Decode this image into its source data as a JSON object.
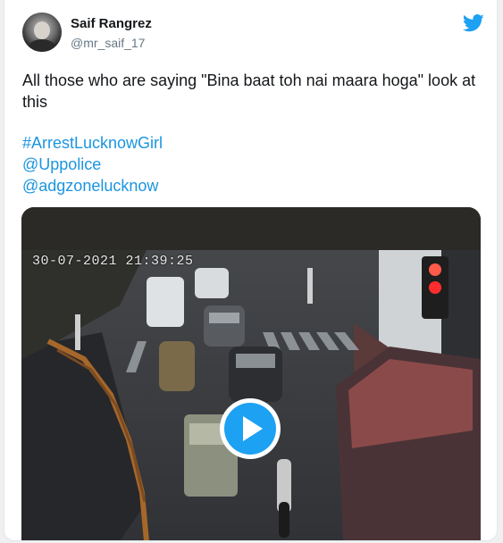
{
  "user": {
    "name": "Saif Rangrez",
    "handle": "@mr_saif_17"
  },
  "tweet": {
    "text": "All those who are saying \"Bina baat toh nai maara hoga\" look at this",
    "hashtag": "#ArrestLucknowGirl",
    "mention_1": "@Uppolice",
    "mention_2": "@adgzonelucknow"
  },
  "video": {
    "timestamp": "30-07-2021 21:39:25"
  },
  "icons": {
    "brand": "twitter-bird-icon",
    "play": "play-icon"
  },
  "colors": {
    "brand_blue": "#1da1f2",
    "link_blue": "#1b95e0",
    "text": "#14171a",
    "muted": "#657786"
  }
}
